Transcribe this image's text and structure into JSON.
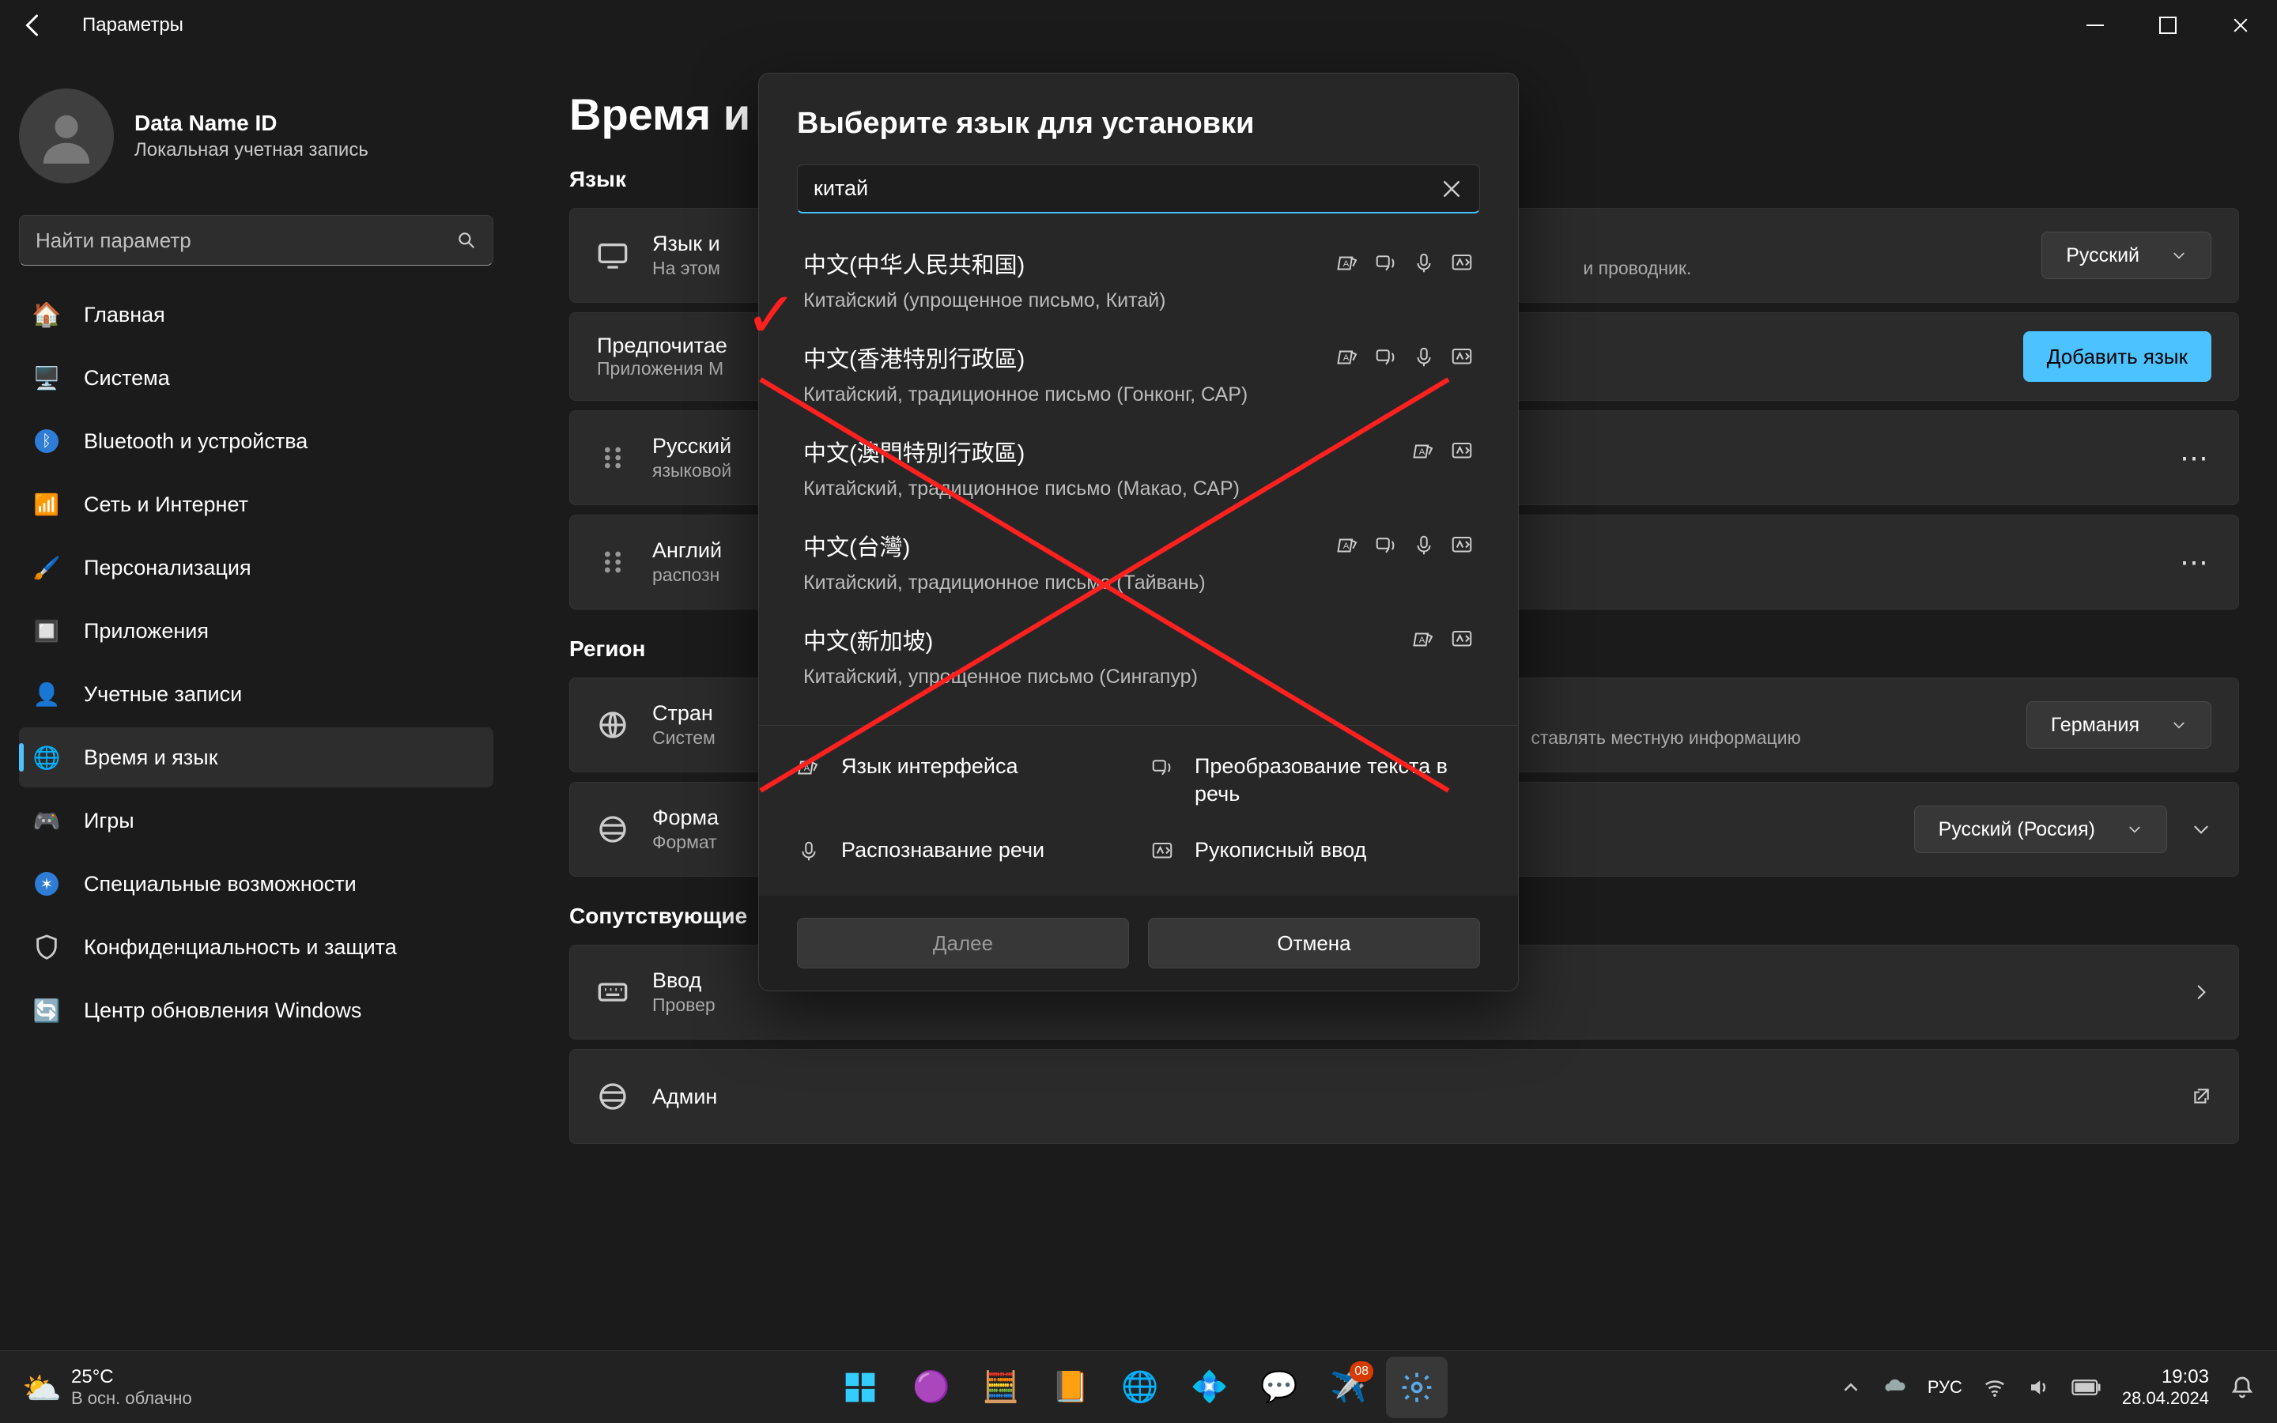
{
  "titlebar": {
    "title": "Параметры"
  },
  "account": {
    "name": "Data Name ID",
    "subtitle": "Локальная учетная запись"
  },
  "search": {
    "placeholder": "Найти параметр"
  },
  "nav": [
    {
      "id": "home",
      "label": "Главная"
    },
    {
      "id": "system",
      "label": "Система"
    },
    {
      "id": "bt",
      "label": "Bluetooth и устройства"
    },
    {
      "id": "net",
      "label": "Сеть и Интернет"
    },
    {
      "id": "pers",
      "label": "Персонализация"
    },
    {
      "id": "apps",
      "label": "Приложения"
    },
    {
      "id": "acct",
      "label": "Учетные записи"
    },
    {
      "id": "time",
      "label": "Время и язык"
    },
    {
      "id": "games",
      "label": "Игры"
    },
    {
      "id": "access",
      "label": "Специальные возможности"
    },
    {
      "id": "priv",
      "label": "Конфиденциальность и защита"
    },
    {
      "id": "update",
      "label": "Центр обновления Windows"
    }
  ],
  "page": {
    "title": "Время и язык",
    "visible_title_fragment": "Время и",
    "section_language": "Язык",
    "section_region": "Регион",
    "section_related": "Сопутствующие",
    "cards": {
      "winlang": {
        "title": "Язык интерфейса Windows",
        "title_visible": "Язык и",
        "sub_visible": "На этом",
        "sub_tail": "и проводник.",
        "value": "Русский"
      },
      "preflang": {
        "title": "Предпочитаемые языки",
        "title_visible": "Предпочитае",
        "sub_visible": "Приложения M",
        "button": "Добавить язык"
      },
      "lang_ru": {
        "title": "Русский",
        "sub": "языковой"
      },
      "lang_en": {
        "title": "Английский",
        "title_visible": "Англий",
        "sub": "распозн"
      },
      "country": {
        "title": "Страна или регион",
        "title_visible": "Стран",
        "sub_visible": "Систем",
        "sub_tail": "ставлять местную информацию",
        "value": "Германия"
      },
      "format": {
        "title": "Формат",
        "title_visible": "Форма",
        "sub_visible": "Формат",
        "value": "Русский (Россия)"
      },
      "typing": {
        "title": "Ввод",
        "sub": "Провер"
      },
      "admin": {
        "title": "Админ"
      }
    }
  },
  "modal": {
    "title": "Выберите язык для установки",
    "search_value": "китай",
    "results": [
      {
        "native": "中文(中华人民共和国)",
        "local": "Китайский (упрощенное письмо, Китай)",
        "feat": [
          "display",
          "tts",
          "speech",
          "hand"
        ]
      },
      {
        "native": "中文(香港特別行政區)",
        "local": "Китайский, традиционное письмо (Гонконг, САР)",
        "feat": [
          "display",
          "tts",
          "speech",
          "hand"
        ]
      },
      {
        "native": "中文(澳門特別行政區)",
        "local": "Китайский, традиционное письмо (Макао, САР)",
        "feat": [
          "display",
          "hand"
        ]
      },
      {
        "native": "中文(台灣)",
        "local": "Китайский, традиционное письмо (Тайвань)",
        "feat": [
          "display",
          "tts",
          "speech",
          "hand"
        ]
      },
      {
        "native": "中文(新加坡)",
        "local": "Китайский, упрощенное письмо (Сингапур)",
        "feat": [
          "display",
          "hand"
        ]
      }
    ],
    "legend": {
      "display": "Язык интерфейса",
      "tts": "Преобразование текста в речь",
      "speech": "Распознавание речи",
      "hand": "Рукописный ввод"
    },
    "actions": {
      "next": "Далее",
      "cancel": "Отмена"
    }
  },
  "annotation": {
    "check_index": 0,
    "cross_start_index": 1
  },
  "taskbar": {
    "weather": {
      "temp": "25°C",
      "desc": "В осн. облачно"
    },
    "badge_tg": "08",
    "tray": {
      "lang": "РУС",
      "time": "19:03",
      "date": "28.04.2024"
    }
  }
}
